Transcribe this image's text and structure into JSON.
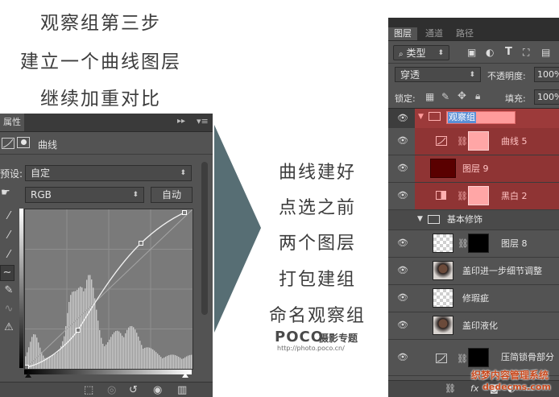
{
  "captions": {
    "top": [
      "观察组第三步",
      "建立一个曲线图层",
      "继续加重对比"
    ],
    "middle": [
      "曲线建好",
      "点选之前",
      "两个图层",
      "打包建组",
      "命名观察组"
    ]
  },
  "watermark": {
    "brand": "POCO",
    "brand_suffix": "摄影专题",
    "url": "http://photo.poco.cn/"
  },
  "properties_panel": {
    "tab_label": "属性",
    "panel_title": "曲线",
    "preset_label": "预设:",
    "preset_value": "自定",
    "channel_value": "RGB",
    "auto_button": "自动"
  },
  "layers_panel": {
    "tabs": [
      "图层",
      "通道",
      "路径"
    ],
    "filter_value": "类型",
    "blend_mode": "穿透",
    "opacity_label": "不透明度:",
    "opacity_value": "100%",
    "lock_label": "锁定:",
    "fill_label": "填充:",
    "fill_value": "100%",
    "layers": [
      {
        "name": "观察组",
        "kind": "group",
        "highlight": true
      },
      {
        "name": "曲线 5",
        "kind": "curves",
        "highlight": true
      },
      {
        "name": "图层 9",
        "kind": "pixel-dark",
        "highlight": true
      },
      {
        "name": "黑白 2",
        "kind": "bw",
        "highlight": true
      },
      {
        "name": "基本修饰",
        "kind": "group",
        "highlight": false
      },
      {
        "name": "图层 8",
        "kind": "pixel-mask",
        "highlight": false
      },
      {
        "name": "盖印进一步细节调整",
        "kind": "photo",
        "highlight": false
      },
      {
        "name": "修瑕疵",
        "kind": "transparent",
        "highlight": false
      },
      {
        "name": "盖印液化",
        "kind": "photo",
        "highlight": false
      },
      {
        "name": "压简锁骨部分",
        "kind": "curves-black",
        "highlight": false
      }
    ]
  },
  "colors": {
    "panel_bg": "#535353",
    "panel_dark": "#3a3a3a",
    "highlight_red": "#9c3a3a",
    "highlight_red_row": "#8f3434",
    "pink_mask": "#ffa6a6",
    "dark_red": "#5a0000",
    "arrow": "#576e74"
  },
  "bottom_watermark": "织梦内容管理系统",
  "bottom_watermark_url": "dedecms.com"
}
